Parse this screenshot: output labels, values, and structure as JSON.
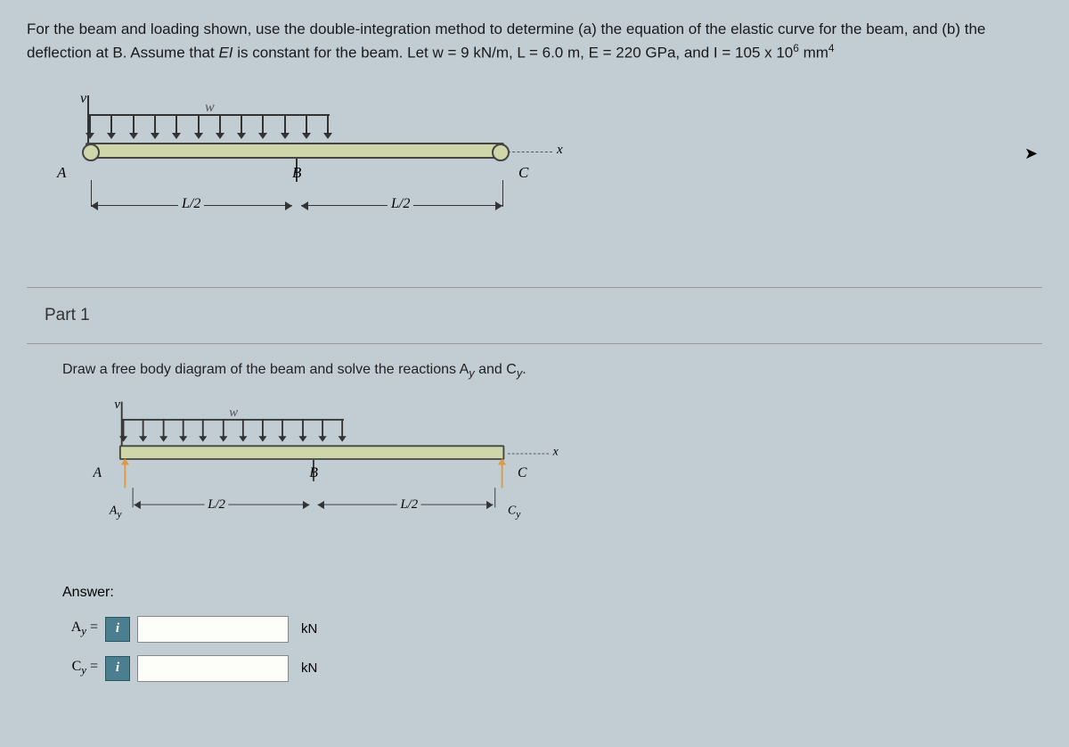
{
  "problem": {
    "text_part1": "For the beam and loading shown, use the double-integration method to determine (a) the equation of the elastic curve for the beam, and (b) the deflection at B. Assume that ",
    "ei": "EI",
    "text_part2": " is constant for the beam. Let w = 9 kN/m, L = 6.0 m, E = 220 GPa, and I = 105 x 10",
    "exp": "6",
    "text_part3": " mm",
    "exp2": "4"
  },
  "diagram": {
    "v": "v",
    "w": "w",
    "A": "A",
    "B": "B",
    "C": "C",
    "x": "x",
    "L2": "L/2",
    "Ay": "A",
    "Ay_sub": "y",
    "Cy": "C",
    "Cy_sub": "y"
  },
  "part1": {
    "title": "Part 1",
    "text_before": "Draw a free body diagram of the beam and solve the reactions A",
    "sub1": "y",
    "text_mid": " and C",
    "sub2": "y",
    "text_end": "."
  },
  "answer": {
    "label": "Answer:",
    "Ay_var": "A",
    "Ay_sub": "y",
    "eq": " = ",
    "Cy_var": "C",
    "Cy_sub": "y",
    "unit": "kN",
    "info": "i",
    "Ay_value": "",
    "Cy_value": ""
  }
}
